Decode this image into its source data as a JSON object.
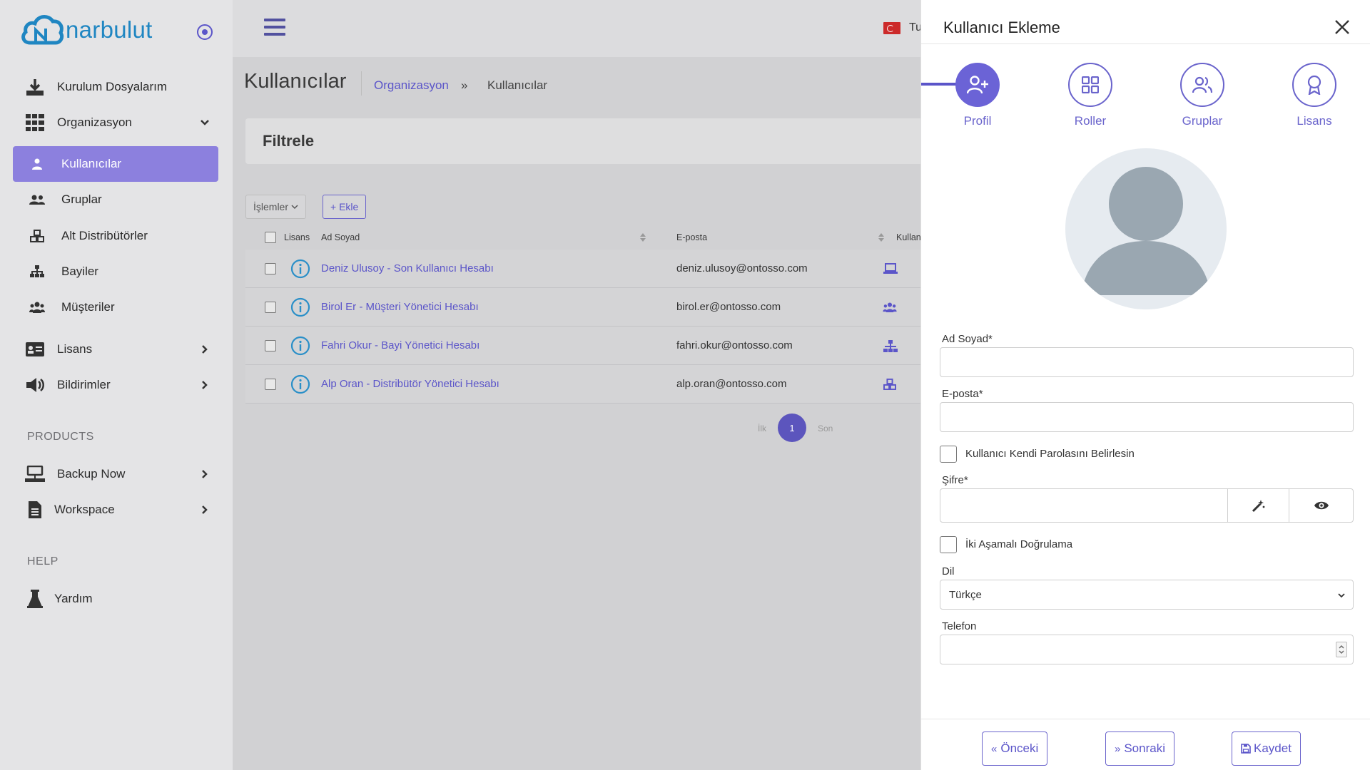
{
  "brand": {
    "name": "narbulut"
  },
  "sidebar": {
    "items": [
      {
        "label": "Kurulum Dosyalarım",
        "icon": "download-icon"
      },
      {
        "label": "Organizasyon",
        "icon": "grid-icon"
      },
      {
        "label": "Kullanıcılar",
        "icon": "user-icon"
      },
      {
        "label": "Gruplar",
        "icon": "users-icon"
      },
      {
        "label": "Alt Distribütörler",
        "icon": "cubes-icon"
      },
      {
        "label": "Bayiler",
        "icon": "sitemap-icon"
      },
      {
        "label": "Müşteriler",
        "icon": "people-icon"
      },
      {
        "label": "Lisans",
        "icon": "id-card-icon"
      },
      {
        "label": "Bildirimler",
        "icon": "megaphone-icon"
      },
      {
        "label": "Backup Now",
        "icon": "network-icon"
      },
      {
        "label": "Workspace",
        "icon": "file-icon"
      },
      {
        "label": "Yardım",
        "icon": "flask-icon"
      }
    ],
    "sections": {
      "products": "PRODUCTS",
      "help": "HELP"
    }
  },
  "topbar": {
    "language": "Tu"
  },
  "page": {
    "title": "Kullanıcılar",
    "breadcrumb": {
      "parent": "Organizasyon",
      "separator": "»",
      "current": "Kullanıcılar"
    }
  },
  "filter": {
    "title": "Filtrele"
  },
  "toolbar": {
    "actions_label": "İşlemler",
    "add_label": "+ Ekle"
  },
  "table": {
    "headers": {
      "license": "Lisans",
      "name": "Ad Soyad",
      "email": "E-posta",
      "user": "Kullanıcı"
    },
    "rows": [
      {
        "name": "Deniz Ulusoy - Son Kullanıcı Hesabı",
        "email": "deniz.ulusoy@ontosso.com",
        "type_icon": "laptop-icon"
      },
      {
        "name": "Birol Er - Müşteri Yönetici Hesabı",
        "email": "birol.er@ontosso.com",
        "type_icon": "people-icon"
      },
      {
        "name": "Fahri Okur - Bayi Yönetici Hesabı",
        "email": "fahri.okur@ontosso.com",
        "type_icon": "sitemap-icon"
      },
      {
        "name": "Alp Oran - Distribütör Yönetici Hesabı",
        "email": "alp.oran@ontosso.com",
        "type_icon": "cubes-icon"
      }
    ]
  },
  "pagination": {
    "first": "İlk",
    "current": "1",
    "last": "Son"
  },
  "drawer": {
    "title": "Kullanıcı Ekleme",
    "steps": [
      {
        "label": "Profil",
        "icon": "user-plus-icon"
      },
      {
        "label": "Roller",
        "icon": "grid-icon"
      },
      {
        "label": "Gruplar",
        "icon": "users-icon"
      },
      {
        "label": "Lisans",
        "icon": "award-icon"
      }
    ],
    "fields": {
      "full_name_label": "Ad Soyad*",
      "full_name_value": "",
      "email_label": "E-posta*",
      "email_value": "",
      "self_password_label": "Kullanıcı Kendi Parolasını Belirlesin",
      "password_label": "Şifre*",
      "password_value": "",
      "two_factor_label": "İki Aşamalı Doğrulama",
      "language_label": "Dil",
      "language_value": "Türkçe",
      "phone_label": "Telefon",
      "phone_value": ""
    },
    "footer": {
      "prev": "Önceki",
      "next": "Sonraki",
      "save": "Kaydet"
    }
  },
  "colors": {
    "accent": "#6b63d6",
    "brand": "#1f86c2",
    "active_menu": "#8c80de",
    "link": "#5b55c9"
  }
}
